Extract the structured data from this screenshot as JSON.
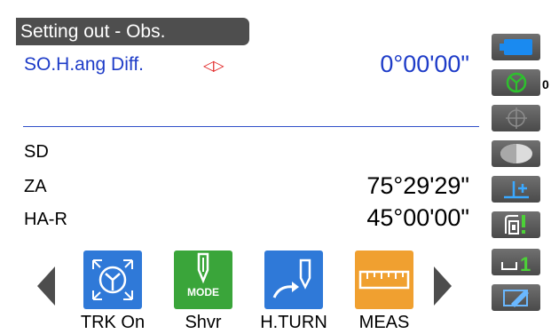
{
  "screen": {
    "title": "Setting out - Obs."
  },
  "setting_out": {
    "label": "SO.H.ang Diff.",
    "direction_indicator": "left-right-arrows",
    "value": "0°00'00\""
  },
  "measurements": [
    {
      "label": "SD",
      "value": ""
    },
    {
      "label": "ZA",
      "value": "75°29'29\""
    },
    {
      "label": "HA-R",
      "value": "45°00'00\""
    }
  ],
  "sidebar": {
    "battery_icon": "battery-icon",
    "target_icon": "prism-target-icon",
    "target_constant": "0",
    "laser_icon": "laser-pointer-icon",
    "tilt_icon": "tilt-icon",
    "height_icon": "height-plus-icon",
    "prism_icon": "prism-warning-icon",
    "page_icon": "page-indicator-icon",
    "page_number": "1",
    "edit_icon": "edit-icon"
  },
  "softkeys": [
    {
      "label": "TRK On",
      "icon": "tracking-icon",
      "color": "#2f79d8"
    },
    {
      "label": "Shvr",
      "icon": "shvr-mode-icon",
      "sub": "MODE",
      "color": "#3aa53a"
    },
    {
      "label": "H.TURN",
      "icon": "h-turn-icon",
      "color": "#2f79d8"
    },
    {
      "label": "MEAS",
      "icon": "meas-ruler-icon",
      "color": "#f0a030"
    }
  ],
  "colors": {
    "accent_blue": "#1e3cc8",
    "arrow_red": "#e01818",
    "battery_blue": "#1a8af0",
    "target_green": "#2ec02e"
  }
}
